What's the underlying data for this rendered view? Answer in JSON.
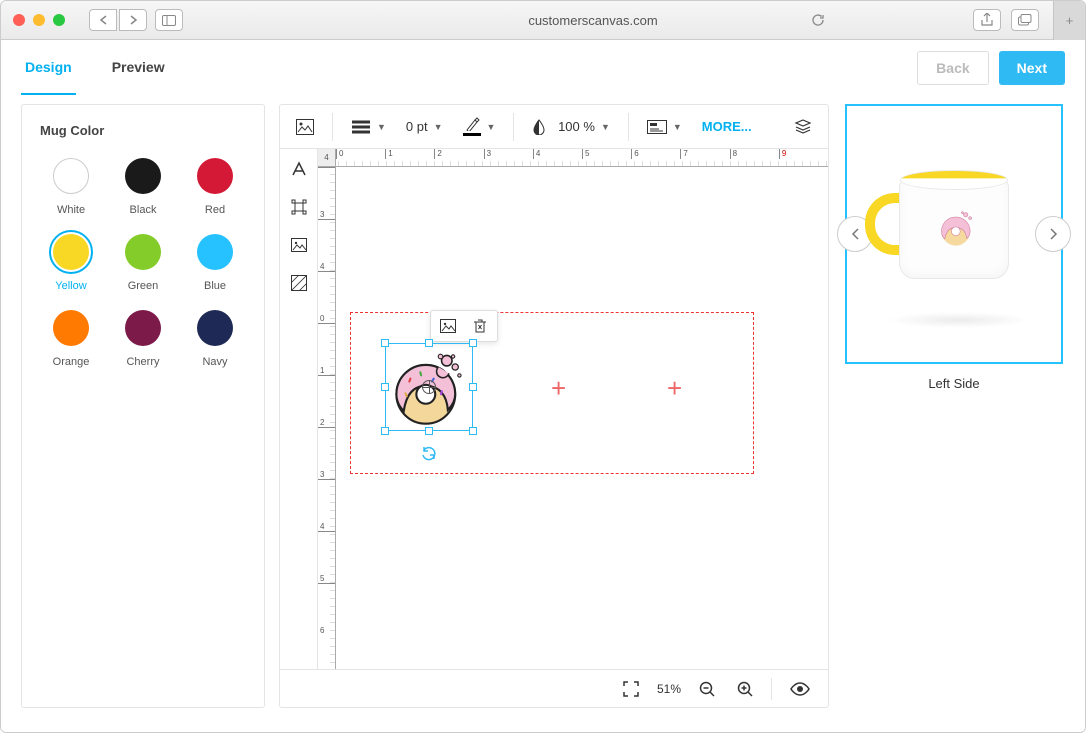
{
  "browser": {
    "url": "customerscanvas.com"
  },
  "tabs": {
    "design": "Design",
    "preview": "Preview",
    "active": "design"
  },
  "buttons": {
    "back": "Back",
    "next": "Next"
  },
  "sidebar": {
    "title": "Mug Color",
    "selected": "Yellow",
    "colors": [
      {
        "name": "White",
        "hex": "#ffffff"
      },
      {
        "name": "Black",
        "hex": "#1a1a1a"
      },
      {
        "name": "Red",
        "hex": "#d41936"
      },
      {
        "name": "Yellow",
        "hex": "#f9d825"
      },
      {
        "name": "Green",
        "hex": "#84cc29"
      },
      {
        "name": "Blue",
        "hex": "#26c2ff"
      },
      {
        "name": "Orange",
        "hex": "#ff7a00"
      },
      {
        "name": "Cherry",
        "hex": "#7c1a4a"
      },
      {
        "name": "Navy",
        "hex": "#1e2a55"
      }
    ]
  },
  "toolbar": {
    "stroke_width": "0 pt",
    "opacity": "100 %",
    "more": "MORE..."
  },
  "ruler": {
    "h": [
      "0",
      "1",
      "2",
      "3",
      "4",
      "5",
      "6",
      "7",
      "8",
      "9"
    ],
    "h_origin": "4",
    "v": [
      "3",
      "4",
      "0",
      "1",
      "2",
      "3",
      "4",
      "5",
      "6"
    ]
  },
  "status": {
    "zoom": "51%"
  },
  "preview": {
    "label": "Left Side"
  }
}
